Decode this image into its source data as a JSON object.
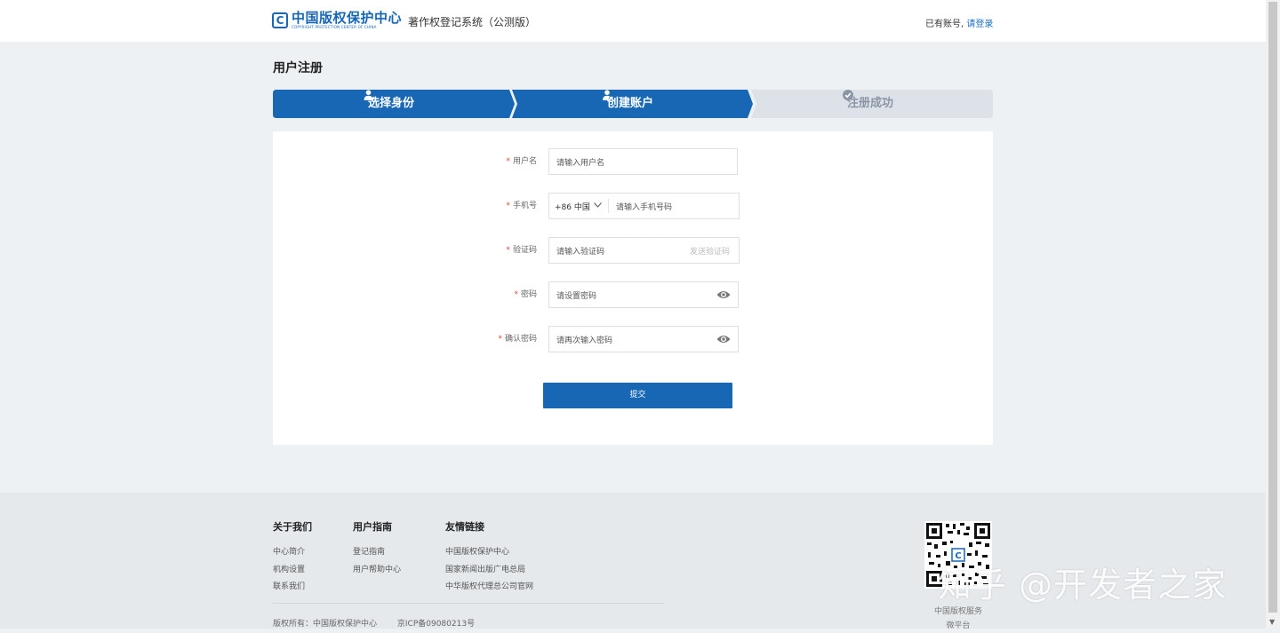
{
  "header": {
    "logo_cn": "中国版权保护中心",
    "logo_en": "COPYRIGHT PROTECTION CENTER OF CHINA",
    "logo_mark": "C",
    "system_title": "著作权登记系统（公测版）",
    "login_hint": "已有账号,",
    "login_link": "请登录"
  },
  "page": {
    "title": "用户注册"
  },
  "steps": [
    {
      "label": "选择身份",
      "icon": "user-icon",
      "state": "done"
    },
    {
      "label": "创建账户",
      "icon": "user-edit-icon",
      "state": "active"
    },
    {
      "label": "注册成功",
      "icon": "check-circle-icon",
      "state": "pending"
    }
  ],
  "colors": {
    "primary": "#1767b5",
    "pending_step": "#dde2e8",
    "required": "#e0443a"
  },
  "form": {
    "username": {
      "label": "用户名",
      "placeholder": "请输入用户名"
    },
    "phone": {
      "label": "手机号",
      "country_code": "+86 中国",
      "placeholder": "请输入手机号码"
    },
    "code": {
      "label": "验证码",
      "placeholder": "请输入验证码",
      "send_label": "发送验证码"
    },
    "password": {
      "label": "密码",
      "placeholder": "请设置密码"
    },
    "confirm": {
      "label": "确认密码",
      "placeholder": "请再次输入密码"
    },
    "submit_label": "提交"
  },
  "footer": {
    "columns": [
      {
        "title": "关于我们",
        "links": [
          "中心简介",
          "机构设置",
          "联系我们"
        ]
      },
      {
        "title": "用户指南",
        "links": [
          "登记指南",
          "用户帮助中心"
        ]
      },
      {
        "title": "友情链接",
        "links": [
          "中国版权保护中心",
          "国家新闻出版广电总局",
          "中华版权代理总公司官网"
        ]
      }
    ],
    "copyright": "版权所有：中国版权保护中心",
    "icp": "京ICP备09080213号",
    "qr_caption_1": "中国版权服务",
    "qr_caption_2": "微平台"
  },
  "watermark": "知乎 @开发者之家"
}
